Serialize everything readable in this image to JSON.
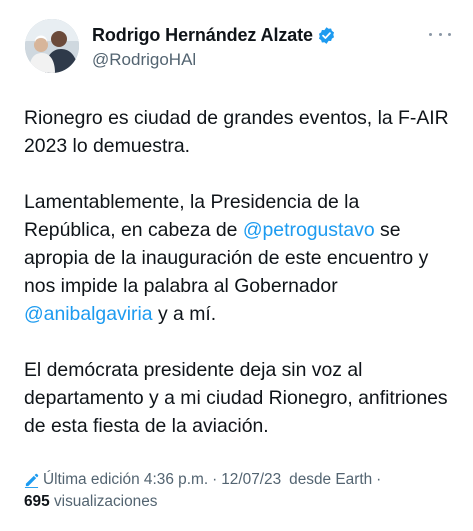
{
  "author": {
    "display_name": "Rodrigo Hernández Alzate",
    "handle": "@RodrigoHAl",
    "verified": true
  },
  "tweet": {
    "para1": "Rionegro es ciudad de grandes eventos, la F-AIR 2023 lo demuestra.",
    "para2_a": "Lamentablemente, la Presidencia de la República, en cabeza de ",
    "mention1": "@petrogustavo",
    "para2_b": " se apropia de la inauguración de este encuentro y nos impide la palabra al Gobernador ",
    "mention2": "@anibalgaviria",
    "para2_c": " y a mí.",
    "para3": "El demócrata presidente deja sin voz al departamento y a mi ciudad Rionegro, anfitriones de esta fiesta de la aviación."
  },
  "meta": {
    "edited_label": "Última edición 4:36 p.m.",
    "date": "12/07/23",
    "source": "desde Earth",
    "separator": "·",
    "views_count": "695",
    "views_label": "visualizaciones"
  },
  "icons": {
    "avatar": "profile-photo",
    "verified": "verified-badge-icon",
    "more": "more-options-icon",
    "edit": "pencil-edit-icon"
  },
  "colors": {
    "link": "#1d9bf0",
    "secondary_text": "#536471",
    "primary_text": "#0f1419"
  }
}
